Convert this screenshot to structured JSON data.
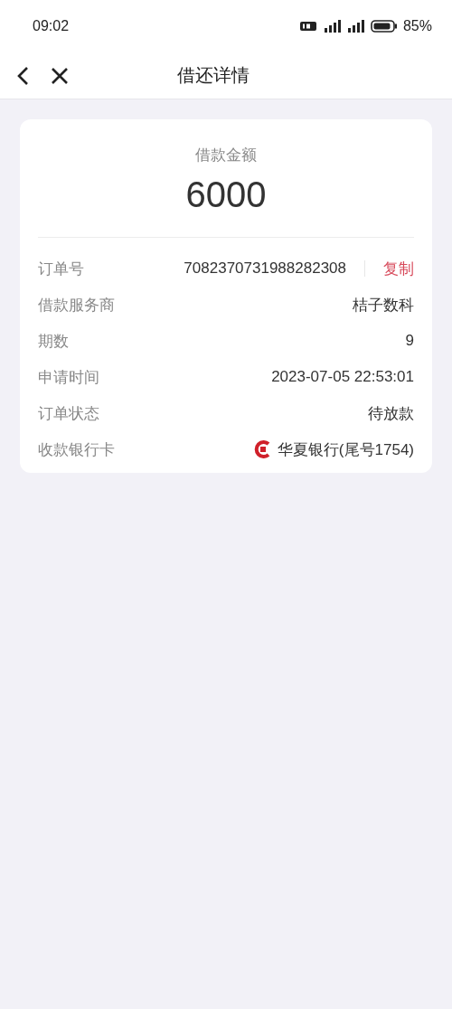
{
  "status_bar": {
    "time": "09:02",
    "battery": "85%"
  },
  "nav": {
    "title": "借还详情"
  },
  "loan": {
    "label": "借款金额",
    "amount": "6000"
  },
  "rows": [
    {
      "kind": "copy",
      "label": "订单号",
      "value": "7082370731988282308",
      "action": "复制"
    },
    {
      "kind": "text",
      "label": "借款服务商",
      "value": "桔子数科"
    },
    {
      "kind": "text",
      "label": "期数",
      "value": "9"
    },
    {
      "kind": "text",
      "label": "申请时间",
      "value": "2023-07-05 22:53:01"
    },
    {
      "kind": "text",
      "label": "订单状态",
      "value": "待放款"
    },
    {
      "kind": "bank",
      "label": "收款银行卡",
      "value": "华夏银行(尾号1754)"
    }
  ]
}
